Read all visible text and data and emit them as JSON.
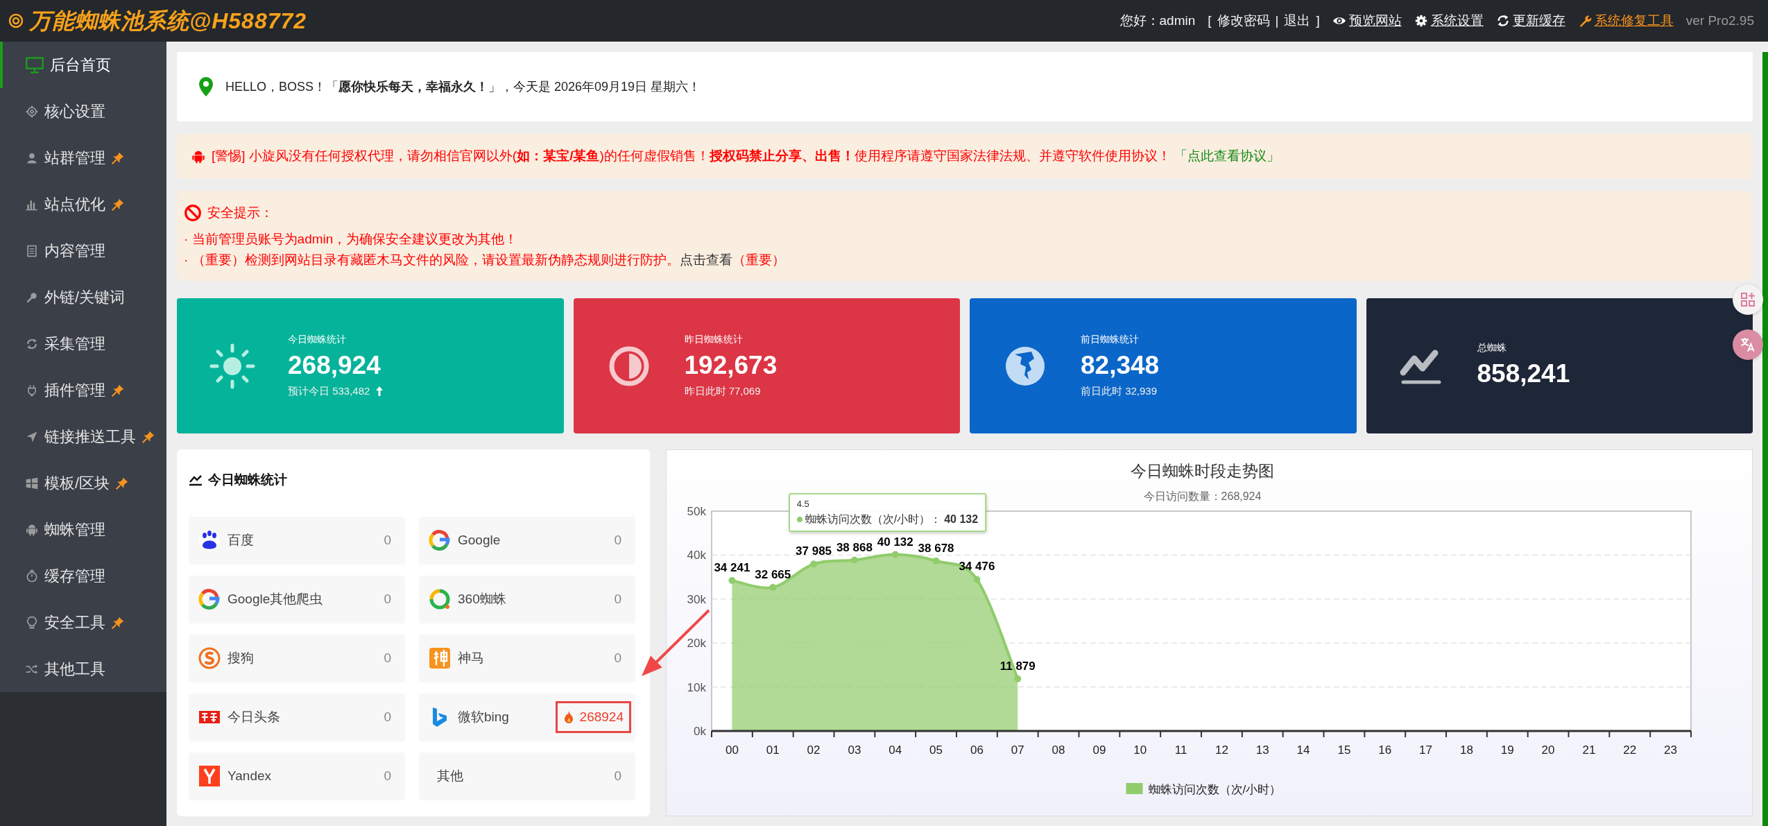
{
  "header": {
    "brand": "万能蜘蛛池系统@H588772",
    "greeting": "您好：admin",
    "account": {
      "open": "[",
      "links": [
        "修改密码",
        "退出"
      ],
      "separator": "|",
      "close": "]"
    },
    "actions": [
      {
        "label": "预览网站",
        "highlighted": false
      },
      {
        "label": "系统设置",
        "highlighted": false
      },
      {
        "label": "更新缓存",
        "highlighted": false
      },
      {
        "label": "系统修复工具",
        "highlighted": true
      }
    ],
    "version": "ver Pro2.95"
  },
  "sidebar": {
    "items": [
      {
        "label": "后台首页",
        "selected": true,
        "pinned": false
      },
      {
        "label": "核心设置",
        "selected": false,
        "pinned": false
      },
      {
        "label": "站群管理",
        "selected": false,
        "pinned": true
      },
      {
        "label": "站点优化",
        "selected": false,
        "pinned": true
      },
      {
        "label": "内容管理",
        "selected": false,
        "pinned": false
      },
      {
        "label": "外链/关键词",
        "selected": false,
        "pinned": false
      },
      {
        "label": "采集管理",
        "selected": false,
        "pinned": false
      },
      {
        "label": "插件管理",
        "selected": false,
        "pinned": true
      },
      {
        "label": "链接推送工具",
        "selected": false,
        "pinned": true
      },
      {
        "label": "模板/区块",
        "selected": false,
        "pinned": true
      },
      {
        "label": "蜘蛛管理",
        "selected": false,
        "pinned": false
      },
      {
        "label": "缓存管理",
        "selected": false,
        "pinned": false
      },
      {
        "label": "安全工具",
        "selected": false,
        "pinned": true
      },
      {
        "label": "其他工具",
        "selected": false,
        "pinned": false
      }
    ]
  },
  "greeting": {
    "text": "HELLO，BOSS！「**愿你快乐每天，幸福永久！**」，今天是 2026年09月19日 星期六！"
  },
  "warning": {
    "text": "[警惕] 小旋风没有任何授权代理，请勿相信官网以外(**如：某宝/某鱼**)的任何虚假销售！**授权码禁止分享、出售！**使用程序请遵守国家法律法规、并遵守软件使用协议！",
    "link": "「点此查看协议」"
  },
  "security": {
    "title": "安全提示：",
    "lines": [
      {
        "text": "· 当前管理员账号为admin，为确保安全建议更改为其他！"
      },
      {
        "text": "· （重要）检测到网站目录有藏匿木马文件的风险，请设置最新伪静态规则进行防护。",
        "link": "点击查看",
        "after": "（重要）"
      }
    ]
  },
  "stats": [
    {
      "label": "今日蜘蛛统计",
      "value": "268,924",
      "note": "预计今日 533,482",
      "trend_up": true,
      "color": "#04b39a"
    },
    {
      "label": "昨日蜘蛛统计",
      "value": "192,673",
      "note": "昨日此时 77,069",
      "trend_up": false,
      "color": "#dc3545"
    },
    {
      "label": "前日蜘蛛统计",
      "value": "82,348",
      "note": "前日此时 32,939",
      "trend_up": false,
      "color": "#0a66c8"
    },
    {
      "label": "总蜘蛛",
      "value": "858,241",
      "trend_up": false,
      "color": "#1e2738"
    }
  ],
  "spider_panel": {
    "title": "今日蜘蛛统计",
    "engines": [
      {
        "name": "百度",
        "count": "0",
        "highlighted": false
      },
      {
        "name": "Google",
        "count": "0",
        "highlighted": false
      },
      {
        "name": "Google其他爬虫",
        "count": "0",
        "highlighted": false
      },
      {
        "name": "360蜘蛛",
        "count": "0",
        "highlighted": false
      },
      {
        "name": "搜狗",
        "count": "0",
        "highlighted": false
      },
      {
        "name": "神马",
        "count": "0",
        "highlighted": false
      },
      {
        "name": "今日头条",
        "count": "0",
        "highlighted": false
      },
      {
        "name": "微软bing",
        "count": "268924",
        "highlighted": true
      },
      {
        "name": "Yandex",
        "count": "0",
        "highlighted": false
      },
      {
        "name": "其他",
        "count": "0",
        "highlighted": false
      }
    ]
  },
  "trend_panel": {
    "subtitle": "今日访问数量：268,924",
    "chart_data": {
      "type": "area",
      "title": "今日蜘蛛时段走势图",
      "categories": [
        "00",
        "01",
        "02",
        "03",
        "04",
        "05",
        "06",
        "07",
        "08",
        "09",
        "10",
        "11",
        "12",
        "13",
        "14",
        "15",
        "16",
        "17",
        "18",
        "19",
        "20",
        "21",
        "22",
        "23"
      ],
      "series": [
        {
          "name": "蜘蛛访问次数（次/小时）",
          "color": "#91cc6c",
          "values": [
            34241,
            32665,
            37985,
            38868,
            40132,
            38678,
            34476,
            11879,
            null,
            null,
            null,
            null,
            null,
            null,
            null,
            null,
            null,
            null,
            null,
            null,
            null,
            null,
            null,
            null
          ]
        }
      ],
      "ylim": [
        0,
        50000
      ],
      "yticks": [
        {
          "value": 0,
          "label": "0k"
        },
        {
          "value": 10000,
          "label": "10k"
        },
        {
          "value": 20000,
          "label": "20k"
        },
        {
          "value": 30000,
          "label": "30k"
        },
        {
          "value": 40000,
          "label": "40k"
        },
        {
          "value": 50000,
          "label": "50k"
        }
      ],
      "grid": true,
      "value_labels": [
        "34 241",
        "32 665",
        "37 985",
        "38 868",
        "40 132",
        "38 678",
        "34 476",
        "11 879",
        null,
        null,
        null,
        null,
        null,
        null,
        null,
        null,
        null,
        null,
        null,
        null,
        null,
        null,
        null,
        null
      ]
    },
    "tooltip": {
      "title": "4.5",
      "label": "蜘蛛访问次数（次/小时）：",
      "value": "40 132"
    }
  }
}
